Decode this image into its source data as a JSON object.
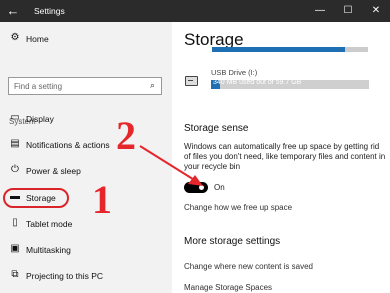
{
  "window": {
    "title": "Settings",
    "back_icon": "back-arrow-icon"
  },
  "sidebar": {
    "home_label": "Home",
    "search_placeholder": "Find a setting",
    "section_label": "System",
    "items": [
      {
        "label": "Display",
        "icon": "display-icon"
      },
      {
        "label": "Notifications & actions",
        "icon": "notifications-icon"
      },
      {
        "label": "Power & sleep",
        "icon": "power-icon"
      },
      {
        "label": "Storage",
        "icon": "storage-icon",
        "selected": true
      },
      {
        "label": "Tablet mode",
        "icon": "tablet-mode-icon"
      },
      {
        "label": "Multitasking",
        "icon": "multitasking-icon"
      },
      {
        "label": "Projecting to this PC",
        "icon": "projecting-icon"
      }
    ]
  },
  "main": {
    "title": "Storage",
    "drive": {
      "name": "USB Drive (I:)",
      "usage": "340 MB used out of 59.7 GB",
      "used_fraction": 0.06
    },
    "storage_sense": {
      "heading": "Storage sense",
      "description": "Windows can automatically free up space by getting rid of files you don't need, like temporary files and content in your recycle bin",
      "toggle_state": "On",
      "link": "Change how we free up space"
    },
    "more": {
      "heading": "More storage settings",
      "link1": "Change where new content is saved",
      "link2": "Manage Storage Spaces"
    }
  },
  "annotations": {
    "one": "1",
    "two": "2"
  },
  "colors": {
    "accent": "#1f6fb5",
    "annotation": "#e5262b",
    "titlebar": "#2b2b2b"
  }
}
